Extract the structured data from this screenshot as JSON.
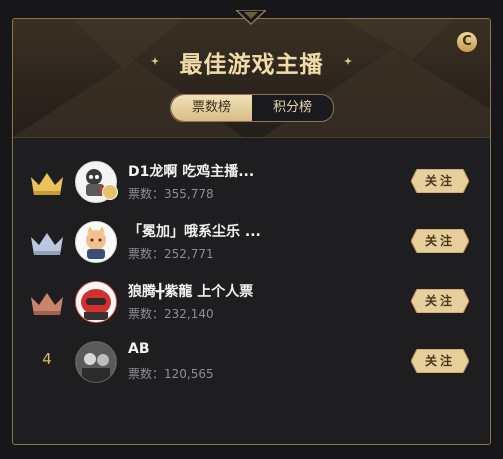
{
  "header": {
    "title": "最佳游戏主播",
    "badge_letter": "C"
  },
  "tabs": [
    {
      "label": "票数榜",
      "active": true
    },
    {
      "label": "积分榜",
      "active": false
    }
  ],
  "ranking": [
    {
      "rank": "1",
      "name": "D1龙啊 吃鸡主播...",
      "votes_label": "票数：",
      "votes": "355,778",
      "crown": "gold",
      "follow_label": "关注"
    },
    {
      "rank": "2",
      "name": "「冕加」哦系尘乐 ...",
      "votes_label": "票数：",
      "votes": "252,771",
      "crown": "silver",
      "follow_label": "关注"
    },
    {
      "rank": "3",
      "name": "狼腾╋紫龍 上个人票",
      "votes_label": "票数：",
      "votes": "232,140",
      "crown": "bronze",
      "follow_label": "关注"
    },
    {
      "rank": "4",
      "name": "AB",
      "votes_label": "票数：",
      "votes": "120,565",
      "crown": "none",
      "follow_label": "关注"
    }
  ],
  "colors": {
    "gold": "#e9c25a",
    "silver": "#b9c8dc",
    "bronze": "#c9846a",
    "accent": "#d7b86f"
  }
}
